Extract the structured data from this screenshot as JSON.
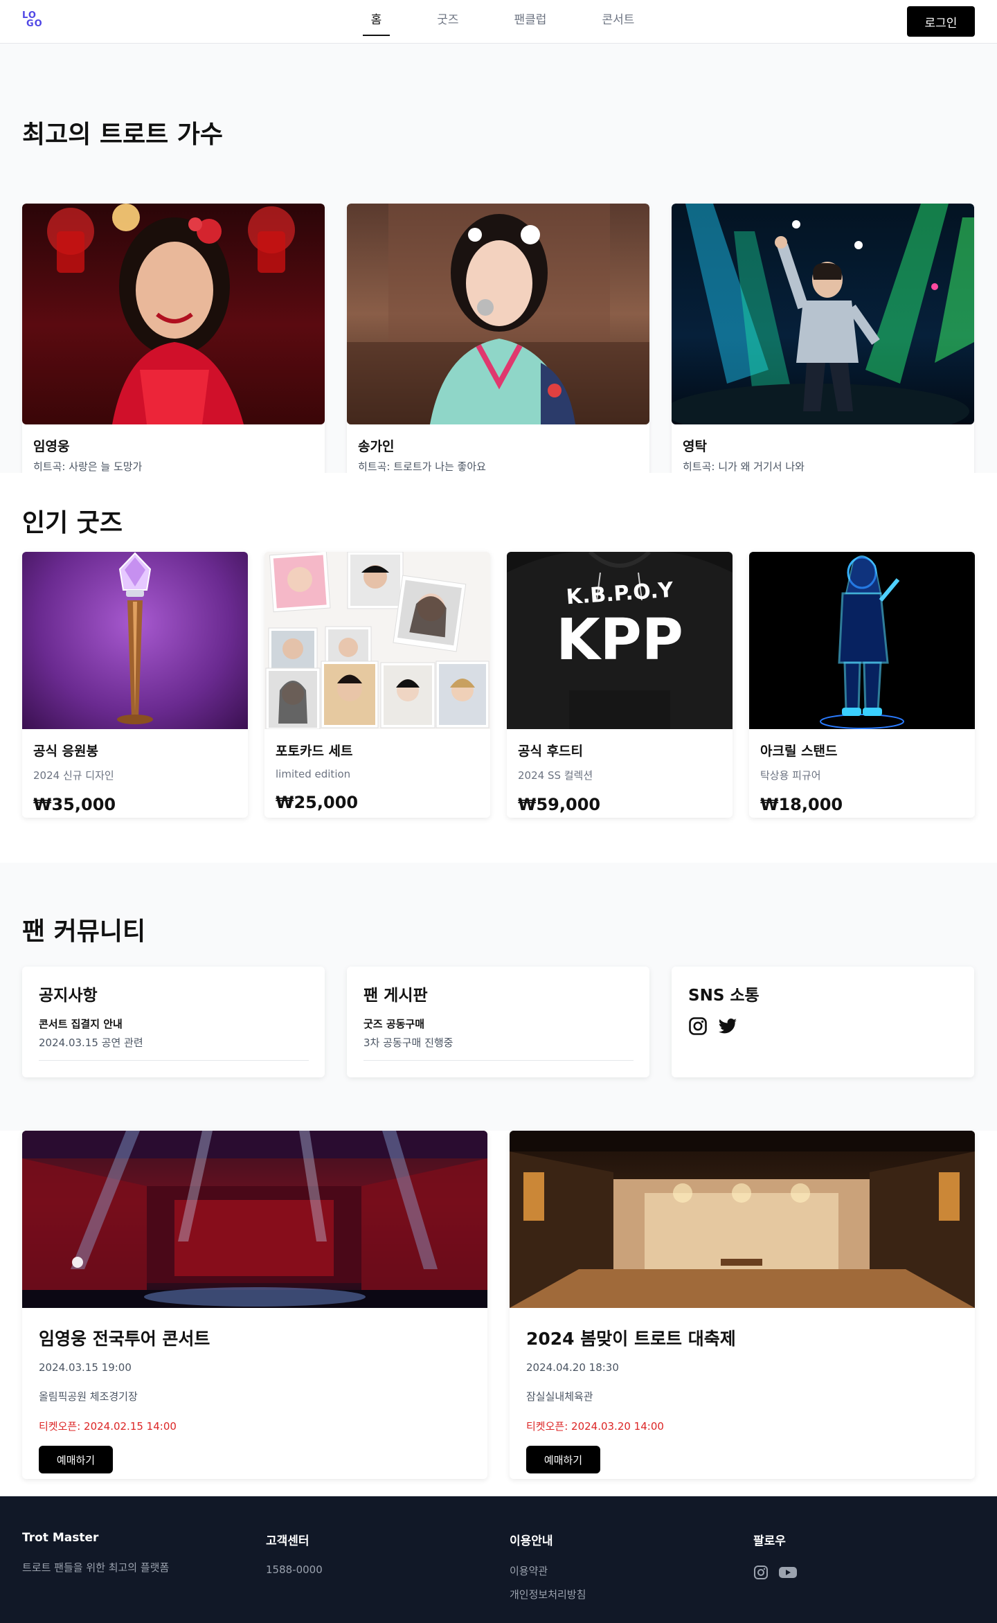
{
  "header": {
    "logo_top": "LO",
    "logo_bottom": "GO",
    "nav": [
      "홈",
      "굿즈",
      "팬클럽",
      "콘서트"
    ],
    "active_nav": "홈",
    "login_label": "로그인"
  },
  "singers": {
    "title": "최고의 트로트 가수",
    "items": [
      {
        "name": "임영웅",
        "hit": "히트곡: 사랑은 늘 도망가"
      },
      {
        "name": "송가인",
        "hit": "히트곡: 트로트가 나는 좋아요"
      },
      {
        "name": "영탁",
        "hit": "히트곡: 니가 왜 거기서 나와"
      }
    ]
  },
  "goods": {
    "title": "인기 굿즈",
    "items": [
      {
        "name": "공식 응원봉",
        "desc": "2024 신규 디자인",
        "price": "₩35,000"
      },
      {
        "name": "포토카드 세트",
        "desc": "limited edition",
        "price": "₩25,000"
      },
      {
        "name": "공식 후드티",
        "desc": "2024 SS 컬렉션",
        "price": "₩59,000"
      },
      {
        "name": "아크릴 스탠드",
        "desc": "탁상용 피규어",
        "price": "₩18,000"
      }
    ],
    "hoodie_print_top": "K.B.P.O.Y",
    "hoodie_print_main": "KPP"
  },
  "community": {
    "title": "팬 커뮤니티",
    "notice": {
      "title": "공지사항",
      "item_title": "콘서트 집결지 안내",
      "item_sub": "2024.03.15 공연 관련"
    },
    "board": {
      "title": "팬 게시판",
      "item_title": "굿즈 공동구매",
      "item_sub": "3차 공동구매 진행중"
    },
    "sns": {
      "title": "SNS 소통"
    }
  },
  "concerts": {
    "items": [
      {
        "title": "임영웅 전국투어 콘서트",
        "datetime": "2024.03.15 19:00",
        "venue": "올림픽공원 체조경기장",
        "ticket": "티켓오픈: 2024.02.15 14:00",
        "button": "예매하기"
      },
      {
        "title": "2024 봄맞이 트로트 대축제",
        "datetime": "2024.04.20 18:30",
        "venue": "잠실실내체육관",
        "ticket": "티켓오픈: 2024.03.20 14:00",
        "button": "예매하기"
      }
    ]
  },
  "footer": {
    "brand": "Trot Master",
    "tagline": "트로트 팬들을 위한 최고의 플랫폼",
    "cs_title": "고객센터",
    "cs_phone": "1588-0000",
    "guide_title": "이용안내",
    "terms": "이용약관",
    "privacy": "개인정보처리방침",
    "follow_title": "팔로우"
  },
  "colors": {
    "accent": "#4f46e5",
    "dark": "#111827",
    "ticket_red": "#dc2626"
  }
}
